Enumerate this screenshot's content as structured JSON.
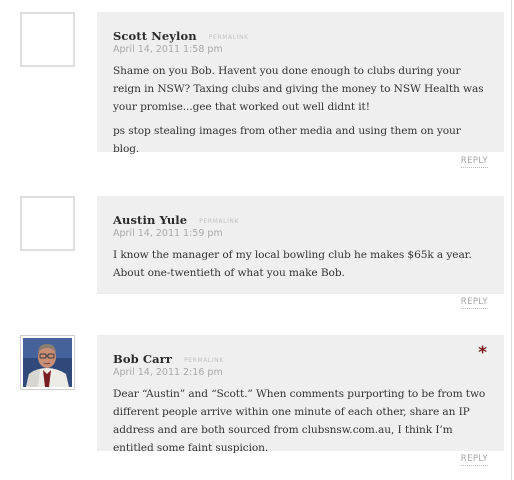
{
  "comments": [
    {
      "author": "Scott Neylon",
      "permalink": "PERMALINK",
      "date": "April 14, 2011 1:58 pm",
      "paragraphs": [
        "Shame on you Bob. Havent you done enough to clubs during your reign in NSW? Taxing clubs and giving the money to NSW Health was your promise...gee that worked out well didnt it!",
        "ps stop stealing images from other media and using them on your blog."
      ],
      "reply": "REPLY",
      "avatar": "blank-avatar-icon"
    },
    {
      "author": "Austin Yule",
      "permalink": "PERMALINK",
      "date": "April 14, 2011 1:59 pm",
      "paragraphs": [
        "I know the manager of my local bowling club he makes $65k a year. About one-twentieth of what you make Bob."
      ],
      "reply": "REPLY",
      "avatar": "blank-avatar-icon"
    },
    {
      "author": "Bob Carr",
      "permalink": "PERMALINK",
      "date": "April 14, 2011 2:16 pm",
      "paragraphs": [
        "Dear “Austin” and “Scott.” When comments purporting to be from two different people arrive within one minute of each other, share an IP address and are both sourced from clubsnsw.com.au, I think I’m entitled some faint suspicion."
      ],
      "reply": "REPLY",
      "avatar": "photo-avatar",
      "author_badge": "*"
    }
  ],
  "colors": {
    "box_background": "#efefef",
    "author_badge": "#7b1a1a",
    "meta_text": "#a9a9a9"
  }
}
